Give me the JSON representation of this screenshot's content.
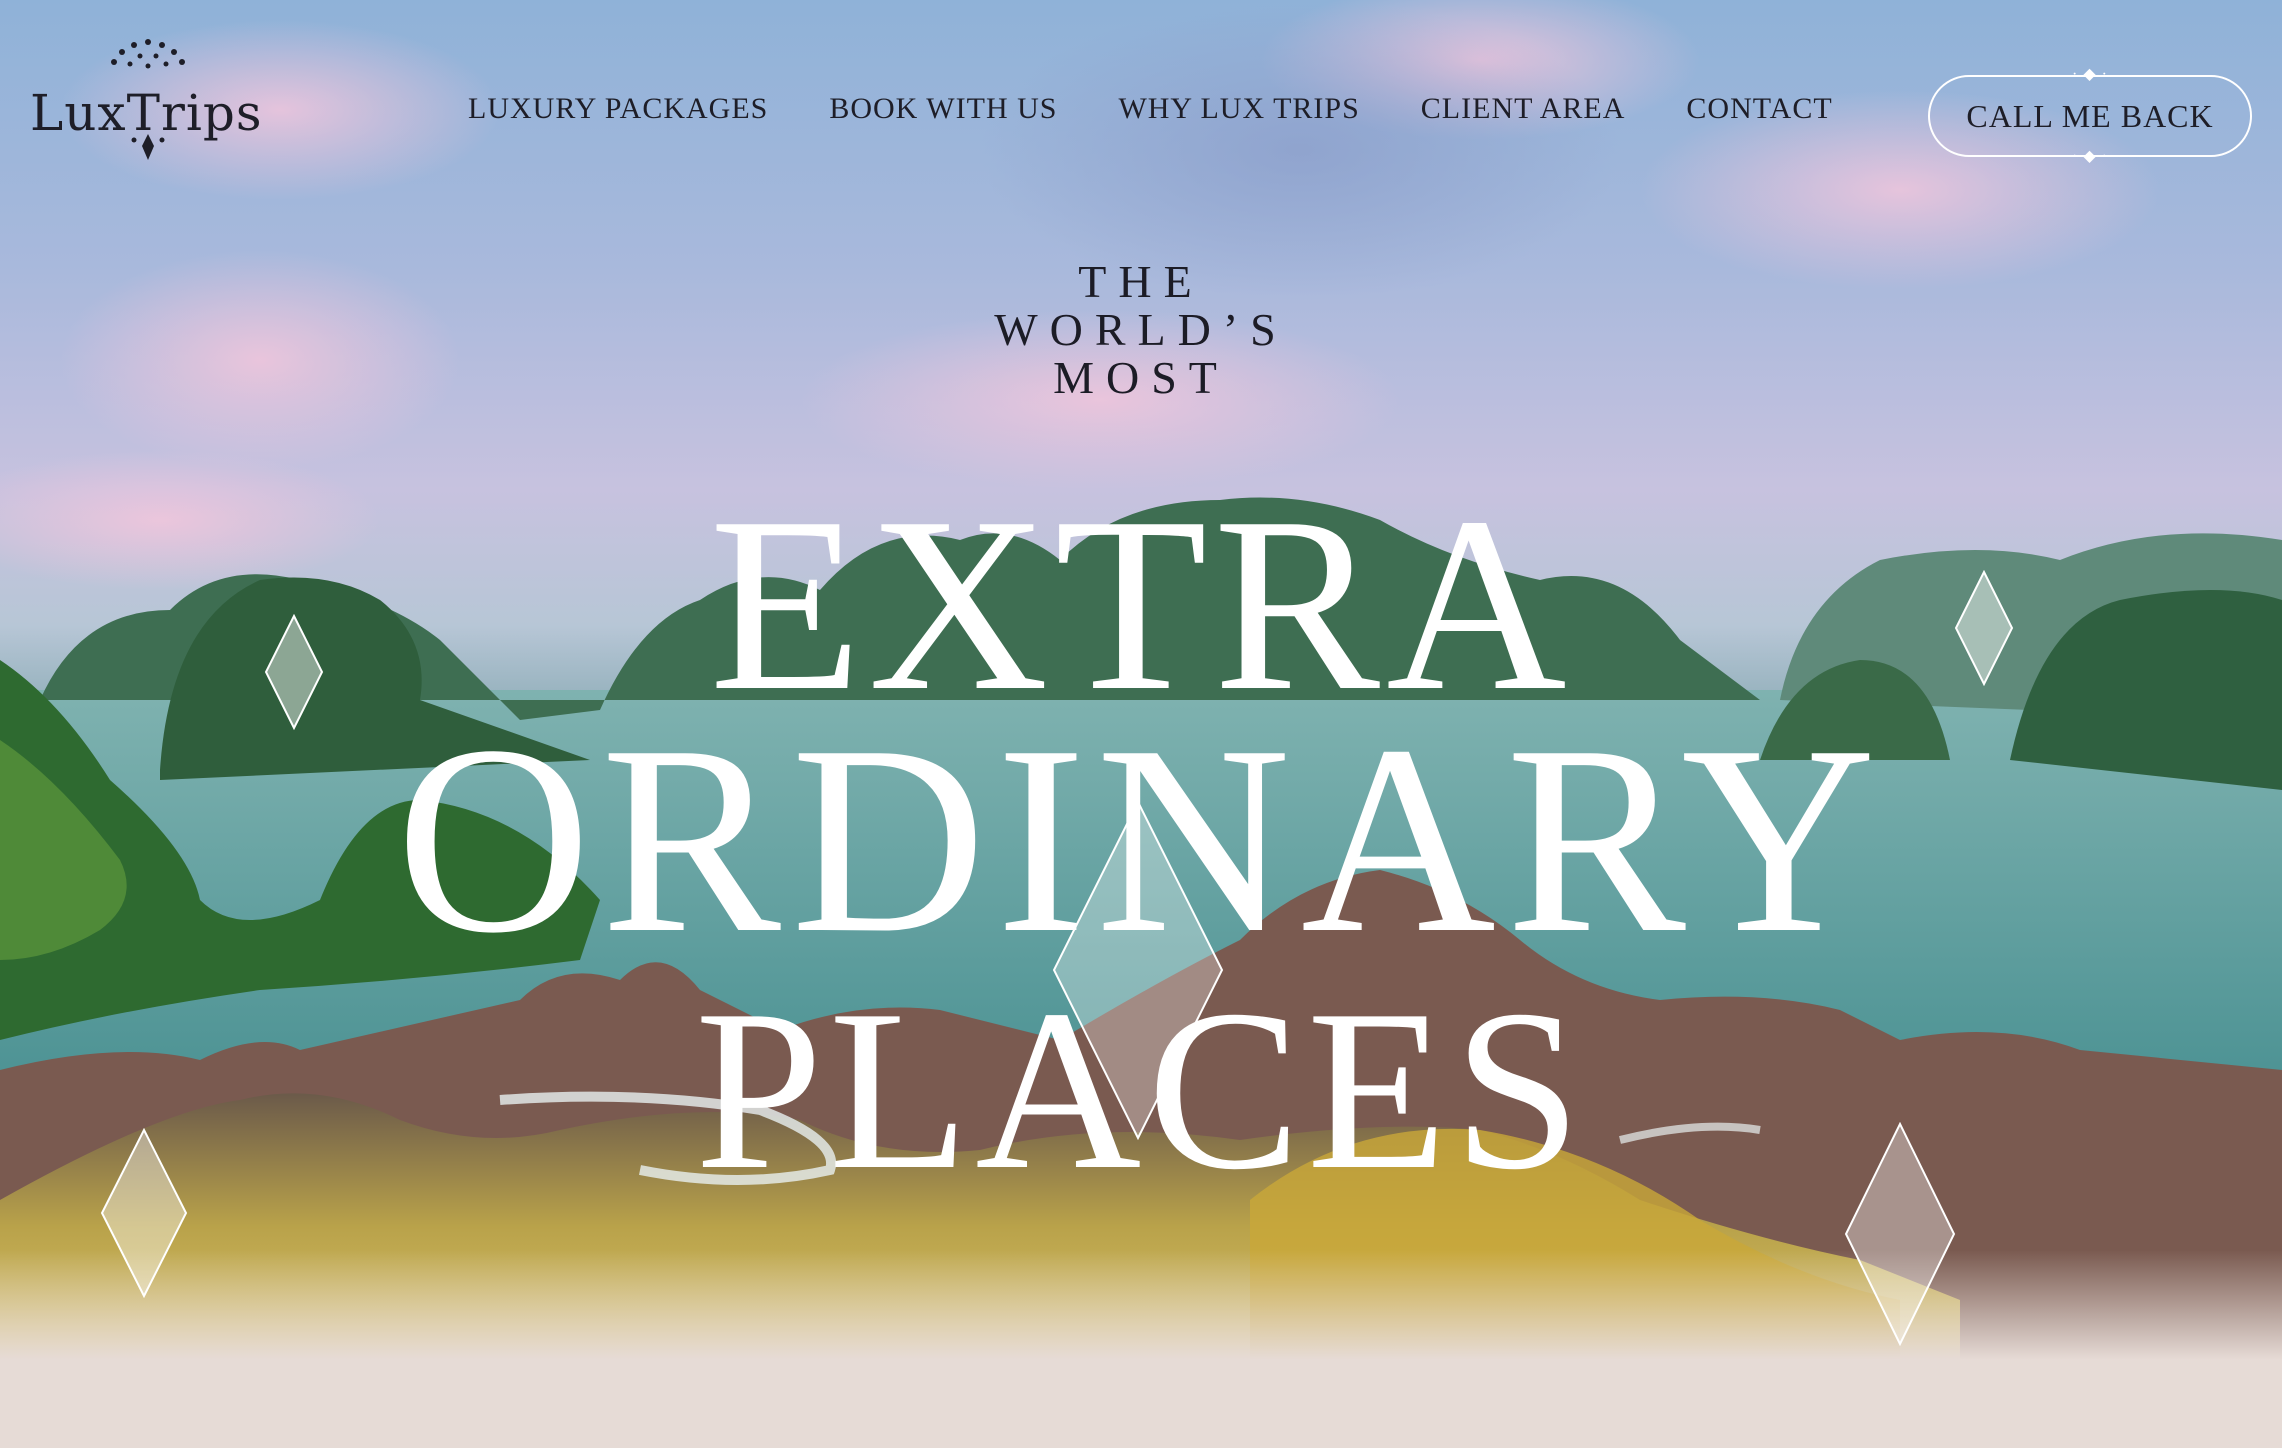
{
  "brand": {
    "name": "LuxTrips"
  },
  "nav": {
    "items": [
      {
        "label": "LUXURY PACKAGES"
      },
      {
        "label": "BOOK WITH US"
      },
      {
        "label": "WHY LUX TRIPS"
      },
      {
        "label": "CLIENT AREA"
      },
      {
        "label": "CONTACT"
      }
    ]
  },
  "cta": {
    "label": "CALL ME BACK"
  },
  "hero": {
    "tagline": [
      "THE",
      "WORLD’S",
      "MOST"
    ],
    "headline": [
      "EXTRA",
      "ORDINARY",
      "PLACES"
    ]
  },
  "colors": {
    "text": "#1e1e28",
    "headline": "#ffffff",
    "band": "#e6dbd6"
  }
}
